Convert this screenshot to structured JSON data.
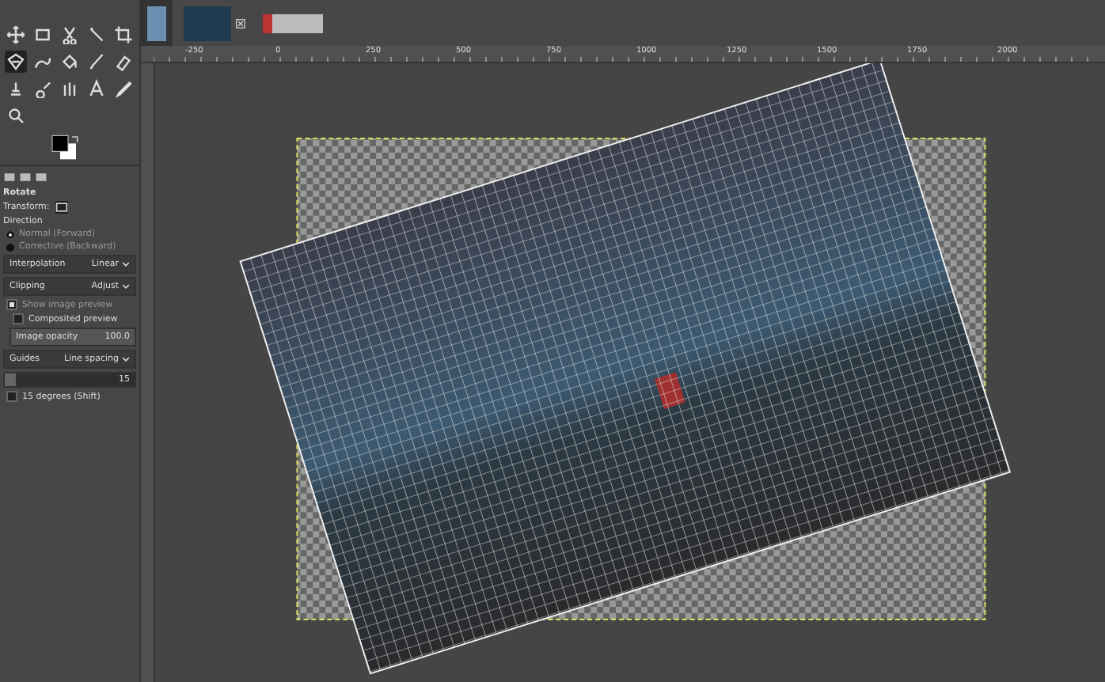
{
  "tools": [
    {
      "kind": "move",
      "selected": false
    },
    {
      "kind": "rect-select",
      "selected": false
    },
    {
      "kind": "scissors",
      "selected": false
    },
    {
      "kind": "wand",
      "selected": false
    },
    {
      "kind": "crop",
      "selected": false
    },
    {
      "kind": "transform",
      "selected": true
    },
    {
      "kind": "warp",
      "selected": false
    },
    {
      "kind": "bucket",
      "selected": false
    },
    {
      "kind": "brush",
      "selected": false
    },
    {
      "kind": "eraser",
      "selected": false
    },
    {
      "kind": "clone",
      "selected": false
    },
    {
      "kind": "smudge",
      "selected": false
    },
    {
      "kind": "path",
      "selected": false
    },
    {
      "kind": "text",
      "selected": false
    },
    {
      "kind": "picker",
      "selected": false
    },
    {
      "kind": "zoom",
      "selected": false
    }
  ],
  "tool_options": {
    "title": "Rotate",
    "transform_label": "Transform:",
    "direction_label": "Direction",
    "directions": [
      {
        "label": "Normal (Forward)",
        "selected": true
      },
      {
        "label": "Corrective (Backward)",
        "selected": false
      }
    ],
    "dropdowns": [
      {
        "label": "Interpolation",
        "value": "Linear"
      },
      {
        "label": "Clipping",
        "value": "Adjust"
      }
    ],
    "show_preview": {
      "label": "Show image preview",
      "checked": true
    },
    "composited": {
      "label": "Composited preview",
      "checked": false
    },
    "opacity": {
      "label": "Image opacity",
      "value": "100.0"
    },
    "guides": {
      "label": "Guides",
      "value": "Line spacing"
    },
    "spacing": {
      "value": "15",
      "level": 0.08
    },
    "constrain": {
      "label": "15 degrees (Shift)",
      "checked": false
    }
  },
  "image_tabs": [
    {
      "kind": "portrait",
      "selected": true,
      "closable": false
    },
    {
      "kind": "night",
      "selected": false,
      "closable": true
    },
    {
      "kind": "pattern",
      "selected": false,
      "closable": false
    }
  ],
  "ruler_labels": [
    "-250",
    "0",
    "250",
    "500",
    "750",
    "1000",
    "1250",
    "1500",
    "1750",
    "2000"
  ]
}
